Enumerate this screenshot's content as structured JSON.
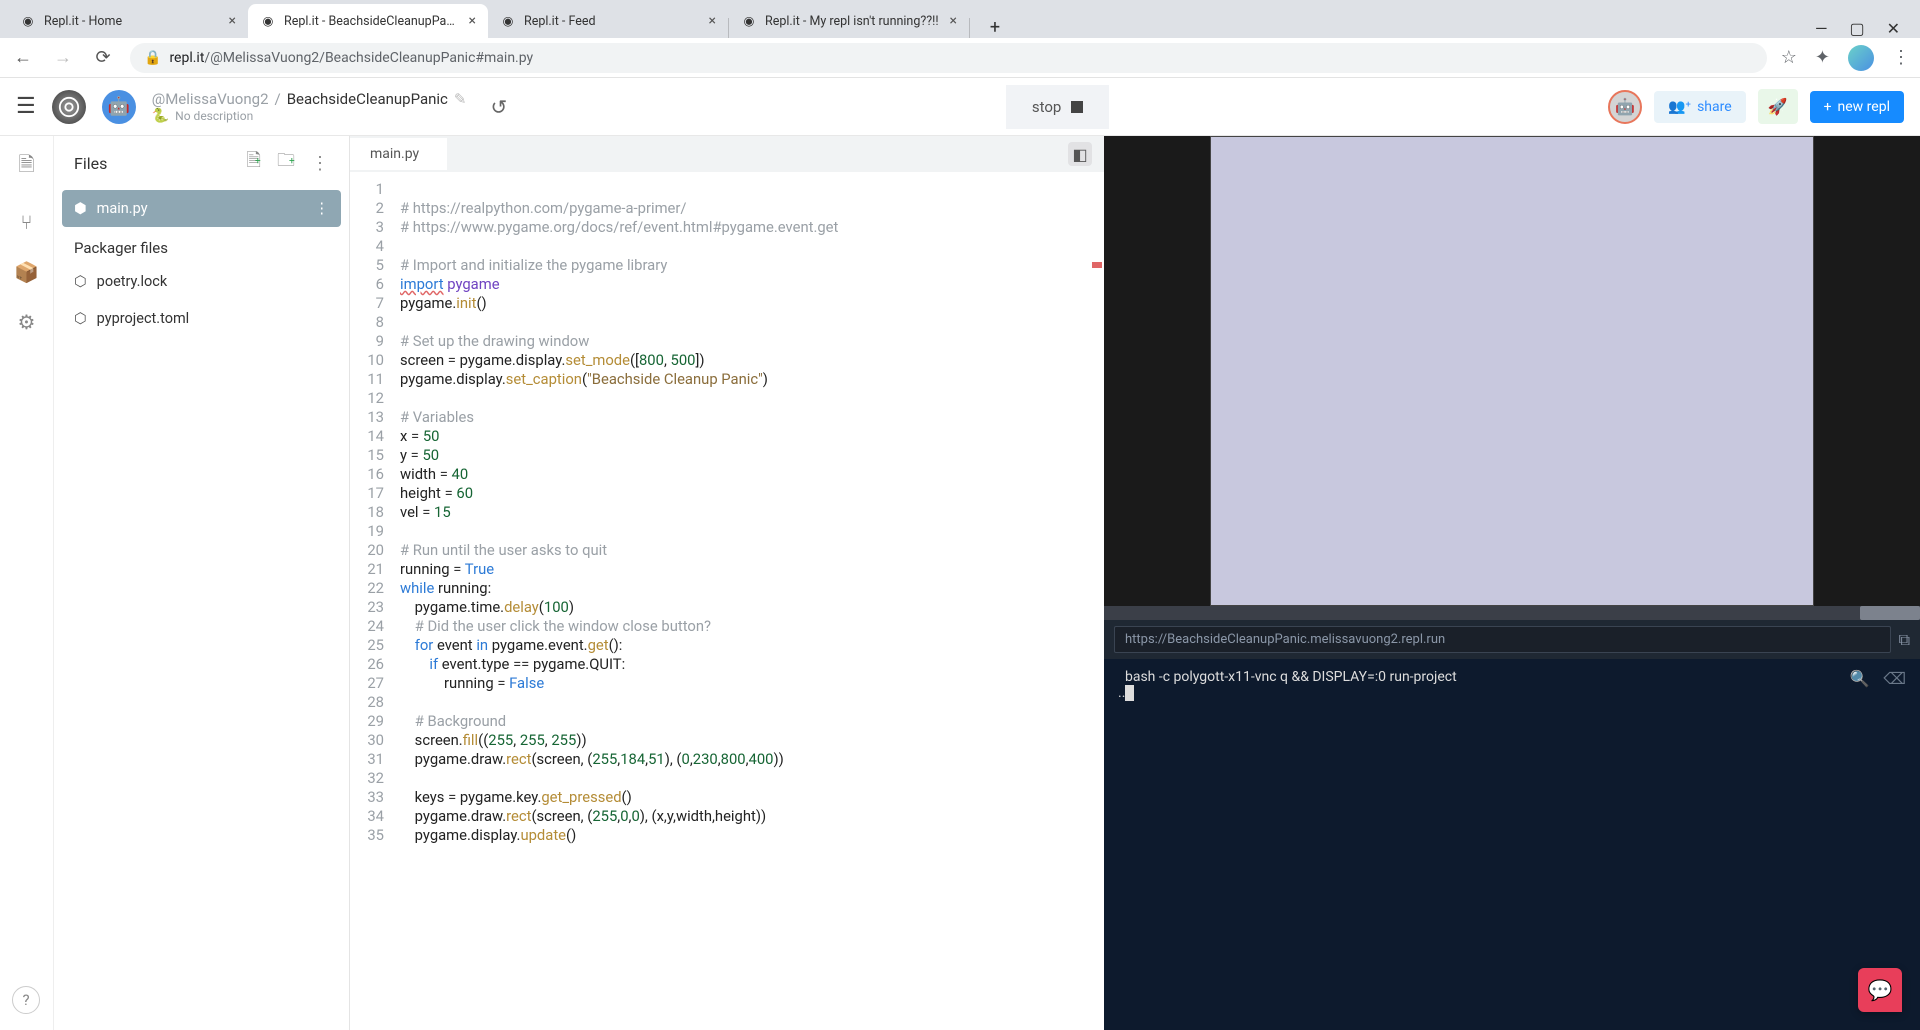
{
  "browser": {
    "tabs": [
      {
        "title": "Repl.it - Home",
        "active": false
      },
      {
        "title": "Repl.it - BeachsideCleanupPanic",
        "active": true
      },
      {
        "title": "Repl.it - Feed",
        "active": false
      },
      {
        "title": "Repl.it - My repl isn't running??!!",
        "active": false
      }
    ],
    "url_host": "repl.it",
    "url_path": "/@MelissaVuong2/BeachsideCleanupPanic#main.py"
  },
  "repl": {
    "user": "@MelissaVuong2",
    "project": "BeachsideCleanupPanic",
    "desc": "No description",
    "stop_label": "stop",
    "share_label": "share",
    "newrepl_label": "new repl"
  },
  "files": {
    "header": "Files",
    "packager_header": "Packager files",
    "items": [
      {
        "name": "main.py",
        "icon": "python",
        "active": true
      }
    ],
    "packager_items": [
      {
        "name": "poetry.lock",
        "icon": "pkg"
      },
      {
        "name": "pyproject.toml",
        "icon": "pkg"
      }
    ]
  },
  "editor": {
    "tab_name": "main.py",
    "lines": [
      {
        "n": 1,
        "html": ""
      },
      {
        "n": 2,
        "html": "<span class='tok-cmt'># https://realpython.com/pygame-a-primer/</span>"
      },
      {
        "n": 3,
        "html": "<span class='tok-cmt'># https://www.pygame.org/docs/ref/event.html#pygame.event.get</span>"
      },
      {
        "n": 4,
        "html": ""
      },
      {
        "n": 5,
        "html": "<span class='tok-cmt'># Import and initialize the pygame library</span>"
      },
      {
        "n": 6,
        "html": "<span class='tok-kw err-underline'>import</span> <span class='tok-mod'>pygame</span>"
      },
      {
        "n": 7,
        "html": "pygame.<span class='tok-fn'>init</span>()"
      },
      {
        "n": 8,
        "html": ""
      },
      {
        "n": 9,
        "html": "<span class='tok-cmt'># Set up the drawing window</span>"
      },
      {
        "n": 10,
        "html": "screen <span class='tok-op'>=</span> pygame.display.<span class='tok-fn'>set_mode</span>([<span class='tok-num'>800</span>, <span class='tok-num'>500</span>])"
      },
      {
        "n": 11,
        "html": "pygame.display.<span class='tok-fn'>set_caption</span>(<span class='tok-str'>\"Beachside Cleanup Panic\"</span>)"
      },
      {
        "n": 12,
        "html": ""
      },
      {
        "n": 13,
        "html": "<span class='tok-cmt'># Variables</span>"
      },
      {
        "n": 14,
        "html": "x <span class='tok-op'>=</span> <span class='tok-num'>50</span>"
      },
      {
        "n": 15,
        "html": "y <span class='tok-op'>=</span> <span class='tok-num'>50</span>"
      },
      {
        "n": 16,
        "html": "width <span class='tok-op'>=</span> <span class='tok-num'>40</span>"
      },
      {
        "n": 17,
        "html": "height <span class='tok-op'>=</span> <span class='tok-num'>60</span>"
      },
      {
        "n": 18,
        "html": "vel <span class='tok-op'>=</span> <span class='tok-num'>15</span>"
      },
      {
        "n": 19,
        "html": ""
      },
      {
        "n": 20,
        "html": "<span class='tok-cmt'># Run until the user asks to quit</span>"
      },
      {
        "n": 21,
        "html": "running <span class='tok-op'>=</span> <span class='tok-bool'>True</span>"
      },
      {
        "n": 22,
        "html": "<span class='tok-kw'>while</span> running:"
      },
      {
        "n": 23,
        "html": "    pygame.time.<span class='tok-fn'>delay</span>(<span class='tok-num'>100</span>)"
      },
      {
        "n": 24,
        "html": "    <span class='tok-cmt'># Did the user click the window close button?</span>"
      },
      {
        "n": 25,
        "html": "    <span class='tok-kw'>for</span> event <span class='tok-kw'>in</span> pygame.event.<span class='tok-fn'>get</span>():"
      },
      {
        "n": 26,
        "html": "        <span class='tok-kw'>if</span> event.type <span class='tok-op'>==</span> pygame.QUIT:"
      },
      {
        "n": 27,
        "html": "            running <span class='tok-op'>=</span> <span class='tok-bool'>False</span>"
      },
      {
        "n": 28,
        "html": ""
      },
      {
        "n": 29,
        "html": "    <span class='tok-cmt'># Background</span>"
      },
      {
        "n": 30,
        "html": "    screen.<span class='tok-fn'>fill</span>((<span class='tok-num'>255</span>, <span class='tok-num'>255</span>, <span class='tok-num'>255</span>))"
      },
      {
        "n": 31,
        "html": "    pygame.draw.<span class='tok-fn'>rect</span>(screen, (<span class='tok-num'>255</span>,<span class='tok-num'>184</span>,<span class='tok-num'>51</span>), (<span class='tok-num'>0</span>,<span class='tok-num'>230</span>,<span class='tok-num'>800</span>,<span class='tok-num'>400</span>))"
      },
      {
        "n": 32,
        "html": ""
      },
      {
        "n": 33,
        "html": "    keys <span class='tok-op'>=</span> pygame.key.<span class='tok-fn'>get_pressed</span>()"
      },
      {
        "n": 34,
        "html": "    pygame.draw.<span class='tok-fn'>rect</span>(screen, (<span class='tok-num'>255</span>,<span class='tok-num'>0</span>,<span class='tok-num'>0</span>), (x,y,width,height))"
      },
      {
        "n": 35,
        "html": "    pygame.display.<span class='tok-fn'>update</span>()"
      }
    ]
  },
  "output": {
    "run_url": "https://BeachsideCleanupPanic.melissavuong2.repl.run",
    "console_cmd": "bash -c polygott-x11-vnc q && DISPLAY=:0 run-project",
    "console_dots": ".."
  }
}
